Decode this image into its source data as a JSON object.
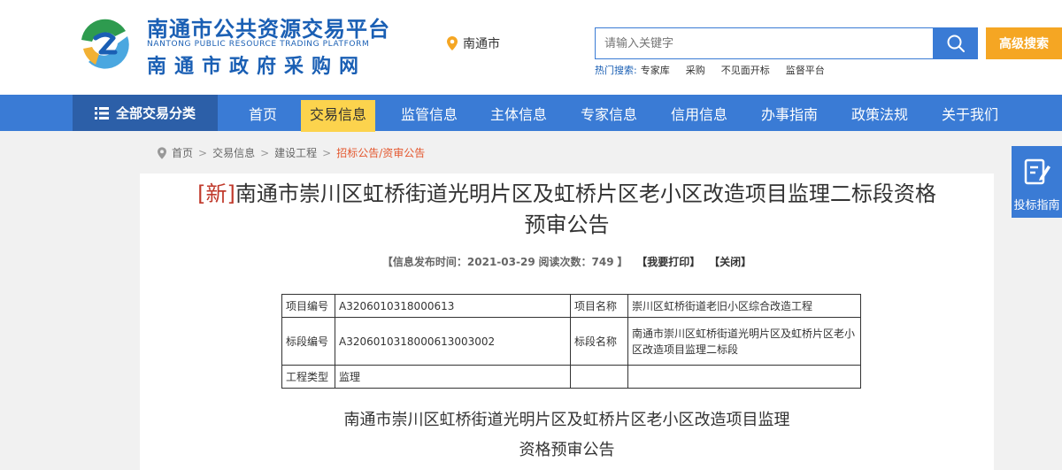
{
  "brand": {
    "name": "南通市公共资源交易平台",
    "name_en": "NANTONG PUBLIC RESOURCE TRADING PLATFORM",
    "sub_name": "南通市政府采购网"
  },
  "location": {
    "label": "南通市",
    "icon": "location-pin-icon"
  },
  "search": {
    "placeholder": "请输入关键字",
    "button_icon": "search-icon",
    "advanced_label": "高级搜索",
    "hot_label": "热门搜索:",
    "hot_items": [
      "专家库",
      "采购",
      "不见面开标",
      "监督平台"
    ]
  },
  "nav": {
    "all_label": "全部交易分类",
    "items": [
      "首页",
      "交易信息",
      "监管信息",
      "主体信息",
      "专家信息",
      "信用信息",
      "办事指南",
      "政策法规",
      "关于我们"
    ],
    "active_index": 1
  },
  "breadcrumb": [
    "首页",
    "交易信息",
    "建设工程",
    "招标公告/资审公告"
  ],
  "article": {
    "new_tag": "[新]",
    "title_line1": "南通市崇川区虹桥街道光明片区及虹桥片区老小区改造项目监理二标段资格",
    "title_line2": "预审公告",
    "meta_prefix": "【信息发布时间：",
    "publish_time": "2021-03-29",
    "views_label": "阅读次数：",
    "views": "749",
    "meta_suffix": "】",
    "print_label": "【我要打印】",
    "close_label": "【关闭】",
    "table": [
      [
        "项目编号",
        "A3206010318000613",
        "项目名称",
        "崇川区虹桥街道老旧小区综合改造工程"
      ],
      [
        "标段编号",
        "A3206010318000613003002",
        "标段名称",
        "南通市崇川区虹桥街道光明片区及虹桥片区老小区改造项目监理二标段"
      ],
      [
        "工程类型",
        "监理",
        "",
        ""
      ]
    ],
    "doc_title_line1": "南通市崇川区虹桥街道光明片区及虹桥片区老小区改造项目监理",
    "doc_title_line2": "资格预审公告"
  },
  "side_button": {
    "label": "投标指南",
    "icon": "document-edit-icon"
  },
  "colors": {
    "brand_blue": "#3a7bd5",
    "nav_dark": "#2c5fa8",
    "accent_yellow": "#fcd34d",
    "advanced_orange": "#f5a623",
    "crumb_current": "#e4572e",
    "new_tag": "#c0392b"
  }
}
